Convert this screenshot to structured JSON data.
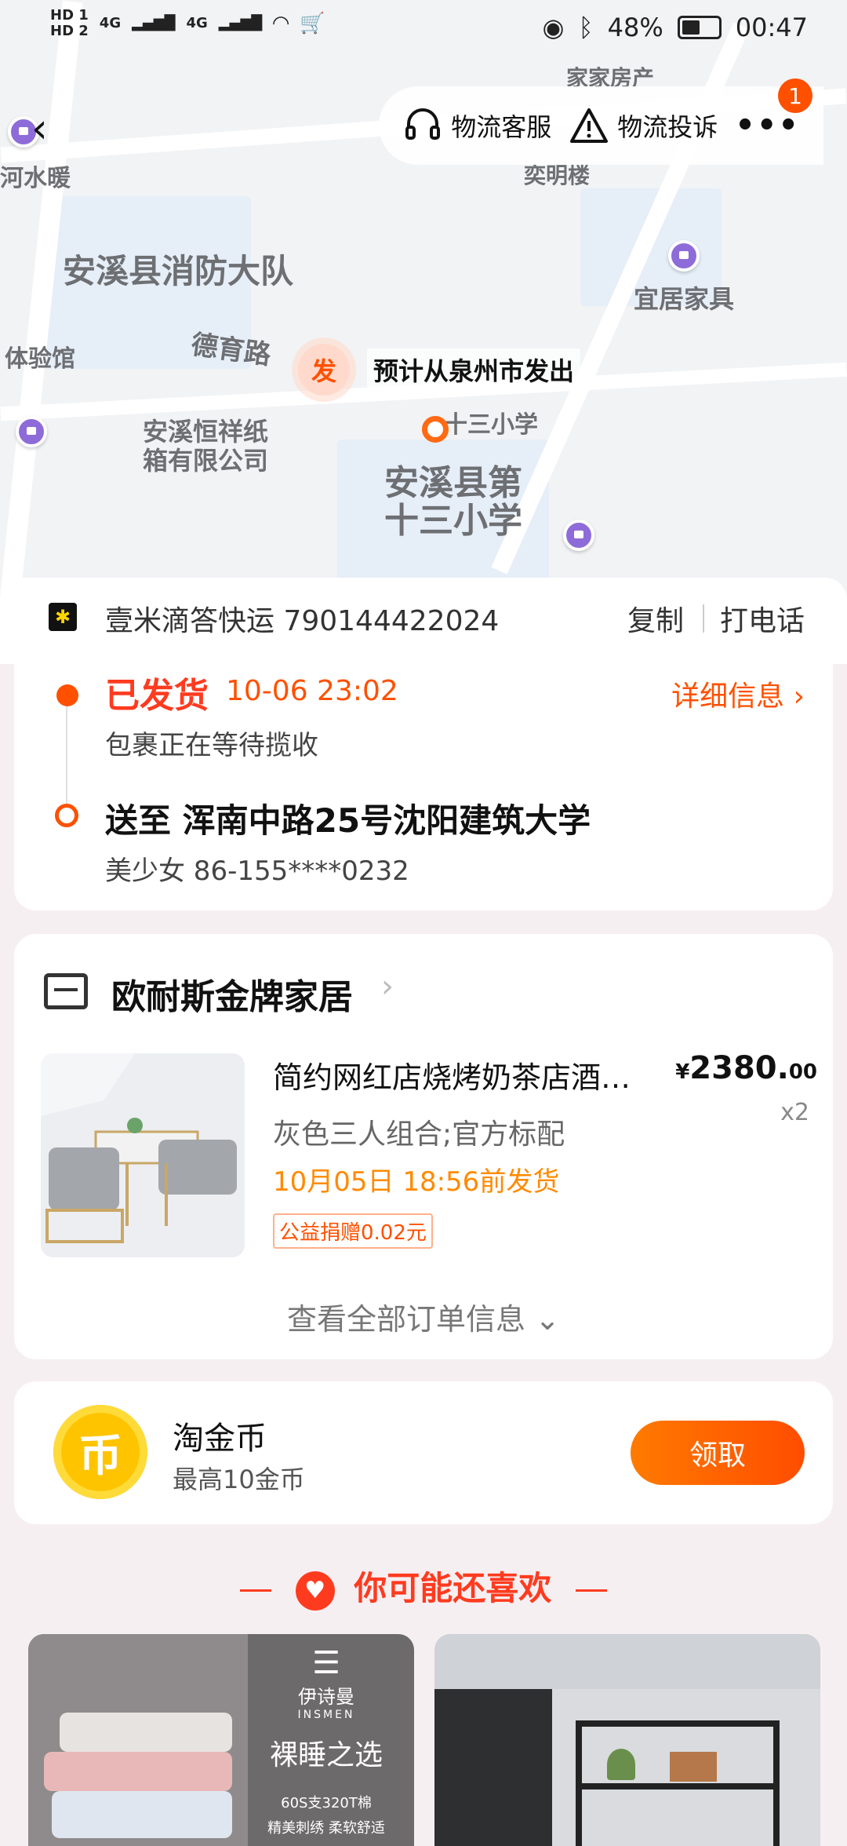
{
  "status_bar": {
    "left_indicators": [
      "HD 1",
      "HD 2",
      "4G",
      "4G"
    ],
    "battery": "48%",
    "time": "00:47"
  },
  "header": {
    "customer_service": "物流客服",
    "complaint": "物流投诉",
    "badge_count": "1"
  },
  "map": {
    "labels": [
      "家家房产",
      "河水暖",
      "奕明楼",
      "安溪县消防大队",
      "宜居家具",
      "德育路",
      "体验馆",
      "安溪恒祥纸\n箱有限公司",
      "十三小学",
      "安溪县第\n十三小学"
    ],
    "marker_symbol": "发",
    "marker_text": "预计从泉州市发出"
  },
  "courier": {
    "name": "壹米滴答快运 790144422024",
    "copy": "复制",
    "call": "打电话"
  },
  "tracking": {
    "status": "已发货",
    "time": "10-06 23:02",
    "detail": "详细信息",
    "sub": "包裹正在等待揽收",
    "address": "送至 浑南中路25号沈阳建筑大学",
    "contact": "美少女 86-155****0232"
  },
  "order": {
    "store": "欧耐斯金牌家居",
    "product_title": "简约网红店烧烤奶茶店酒…",
    "price_symbol": "¥",
    "price_int": "2380.",
    "price_dec": "00",
    "qty": "x2",
    "sku": "灰色三人组合;官方标配",
    "ship": "10月05日 18:56前发货",
    "charity": "公益捐赠0.02元",
    "view_all": "查看全部订单信息"
  },
  "coins": {
    "title": "淘金币",
    "sub": "最高10金币",
    "button": "领取",
    "icon_text": "币"
  },
  "recommend": {
    "title": "你可能还喜欢",
    "left_brand": "伊诗曼",
    "left_brand_en": "INSMEN",
    "left_tag": "裸睡之选",
    "left_lines": [
      "60S支320T棉",
      "精美刺绣 柔软舒适"
    ]
  }
}
